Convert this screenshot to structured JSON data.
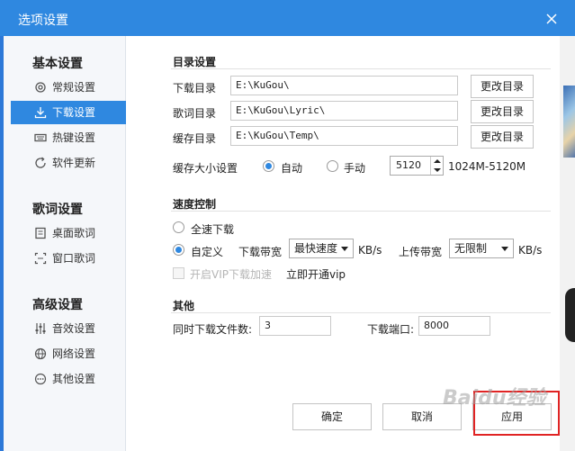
{
  "dialog": {
    "title": "选项设置"
  },
  "sidebar": {
    "groups": [
      {
        "title": "基本设置",
        "items": [
          {
            "label": "常规设置",
            "icon": "gear-icon"
          },
          {
            "label": "下载设置",
            "icon": "download-icon",
            "active": true
          },
          {
            "label": "热键设置",
            "icon": "keyboard-icon"
          },
          {
            "label": "软件更新",
            "icon": "update-icon"
          }
        ]
      },
      {
        "title": "歌词设置",
        "items": [
          {
            "label": "桌面歌词",
            "icon": "desktop-lyric-icon"
          },
          {
            "label": "窗口歌词",
            "icon": "window-lyric-icon"
          }
        ]
      },
      {
        "title": "高级设置",
        "items": [
          {
            "label": "音效设置",
            "icon": "equalizer-icon"
          },
          {
            "label": "网络设置",
            "icon": "network-icon"
          },
          {
            "label": "其他设置",
            "icon": "more-icon"
          }
        ]
      }
    ]
  },
  "directory": {
    "title": "目录设置",
    "rows": [
      {
        "label": "下载目录",
        "value": "E:\\KuGou\\",
        "button": "更改目录"
      },
      {
        "label": "歌词目录",
        "value": "E:\\KuGou\\Lyric\\",
        "button": "更改目录"
      },
      {
        "label": "缓存目录",
        "value": "E:\\KuGou\\Temp\\",
        "button": "更改目录"
      }
    ],
    "cache_size": {
      "label": "缓存大小设置",
      "auto_label": "自动",
      "manual_label": "手动",
      "value": "5120",
      "range": "1024M-5120M"
    }
  },
  "speed": {
    "title": "速度控制",
    "full_label": "全速下载",
    "custom_label": "自定义",
    "download_label": "下载带宽",
    "download_value": "最快速度",
    "download_unit": "KB/s",
    "upload_label": "上传带宽",
    "upload_value": "无限制",
    "upload_unit": "KB/s",
    "vip_label": "开启VIP下载加速",
    "vip_link": "立即开通vip"
  },
  "other": {
    "title": "其他",
    "concurrent_label": "同时下载文件数:",
    "concurrent_value": "3",
    "port_label": "下载端口:",
    "port_value": "8000"
  },
  "footer": {
    "ok": "确定",
    "cancel": "取消",
    "apply": "应用",
    "watermark": "Baidu经验"
  },
  "colors": {
    "accent": "#2f88e0",
    "highlight": "#e02424"
  }
}
